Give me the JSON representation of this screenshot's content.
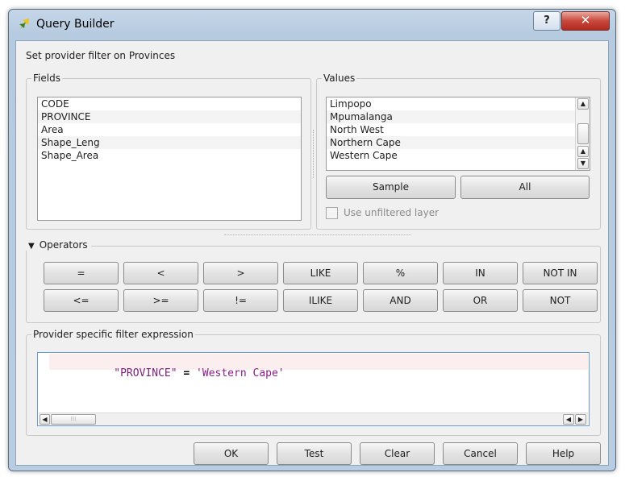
{
  "window": {
    "title": "Query Builder",
    "help_label": "?",
    "close_label": "✕"
  },
  "subtitle": "Set provider filter on Provinces",
  "fields": {
    "label": "Fields",
    "items": [
      "CODE",
      "PROVINCE",
      "Area",
      "Shape_Leng",
      "Shape_Area"
    ]
  },
  "values": {
    "label": "Values",
    "items": [
      "Limpopo",
      "Mpumalanga",
      "North West",
      "Northern Cape",
      "Western Cape"
    ],
    "sample_label": "Sample",
    "all_label": "All",
    "unfiltered_label": "Use unfiltered layer"
  },
  "operators": {
    "label": "Operators",
    "row1": [
      "=",
      "<",
      ">",
      "LIKE",
      "%",
      "IN",
      "NOT IN"
    ],
    "row2": [
      "<=",
      ">=",
      "!=",
      "ILIKE",
      "AND",
      "OR",
      "NOT"
    ]
  },
  "expression": {
    "label": "Provider specific filter expression",
    "field": "\"PROVINCE\"",
    "operator": "=",
    "value": "'Western Cape'",
    "colors": {
      "field": "#7a1e7a",
      "value": "#8a1a8a",
      "line_highlight": "#fbeeee"
    }
  },
  "buttons": {
    "ok": "OK",
    "test": "Test",
    "clear": "Clear",
    "cancel": "Cancel",
    "help": "Help"
  }
}
